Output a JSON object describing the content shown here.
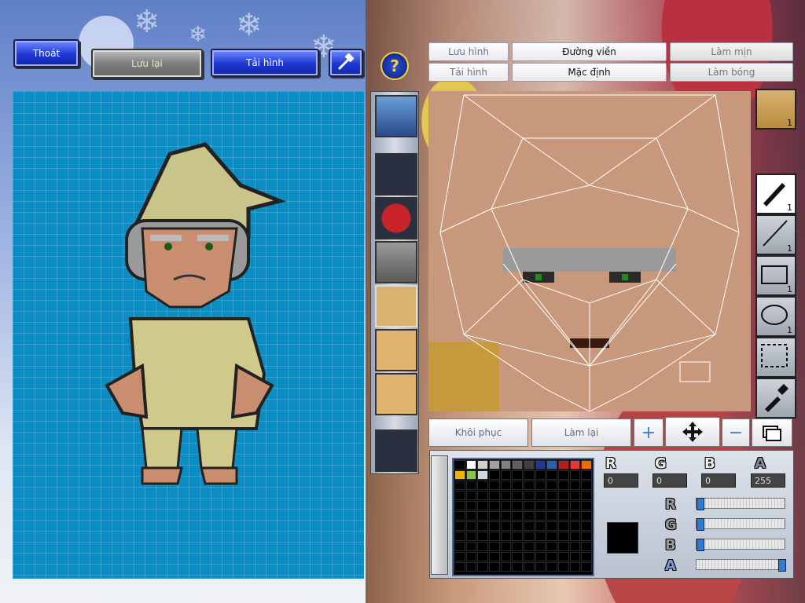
{
  "toolbar": {
    "exit_label": "Thoát",
    "save_label": "Lưu lại",
    "reload_label": "Tải hình"
  },
  "editor_menu": {
    "save_image": "Lưu hình",
    "outline": "Đường viền",
    "smooth": "Làm mịn",
    "load_image": "Tải hình",
    "default": "Mặc định",
    "shine": "Làm bóng"
  },
  "tools": {
    "face_count": "1",
    "pen_count": "1",
    "line_count": "1",
    "rect_count": "1",
    "ellipse_count": "1"
  },
  "bottom_bar": {
    "restore_label": "Khôi phục",
    "redo_label": "Làm lại"
  },
  "color": {
    "r_label": "R",
    "g_label": "G",
    "b_label": "B",
    "a_label": "A",
    "r_value": "0",
    "g_value": "0",
    "b_value": "0",
    "a_value": "255",
    "current": "#000000",
    "slider_r": 0,
    "slider_g": 0,
    "slider_b": 0,
    "slider_a": 1,
    "palette": [
      "#000000",
      "#ffffff",
      "#d0d0d0",
      "#a0a0a0",
      "#808080",
      "#606060",
      "#404040",
      "#1e3a8a",
      "#2c5fa8",
      "#b71c1c",
      "#e53935",
      "#ef6c00",
      "#f0b400",
      "#8bc34a",
      "#cfd8dc"
    ]
  }
}
